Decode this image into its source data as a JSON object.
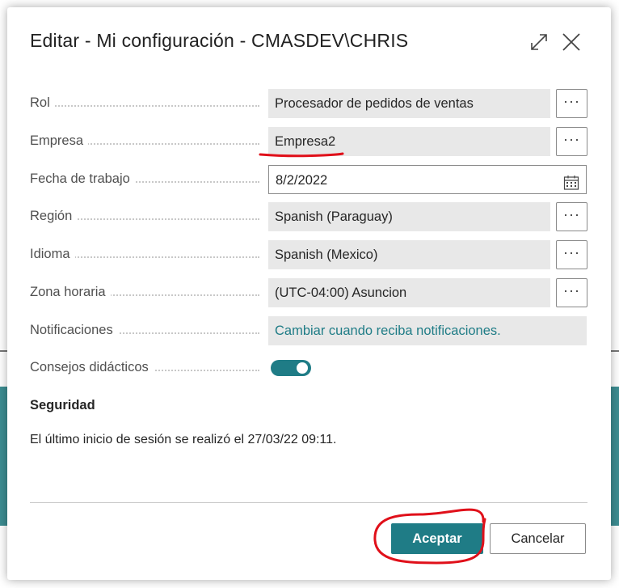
{
  "dialog": {
    "title": "Editar - Mi configuración - CMASDEV\\CHRIS",
    "expand_icon": "expand-icon",
    "close_icon": "close-icon"
  },
  "fields": {
    "rol": {
      "label": "Rol",
      "value": "Procesador de pedidos de ventas"
    },
    "empresa": {
      "label": "Empresa",
      "value": "Empresa2"
    },
    "fecha": {
      "label": "Fecha de trabajo",
      "value": "8/2/2022"
    },
    "region": {
      "label": "Región",
      "value": "Spanish (Paraguay)"
    },
    "idioma": {
      "label": "Idioma",
      "value": "Spanish (Mexico)"
    },
    "zona": {
      "label": "Zona horaria",
      "value": "(UTC-04:00) Asuncion"
    },
    "notificaciones": {
      "label": "Notificaciones",
      "value": "Cambiar cuando reciba notificaciones."
    },
    "consejos": {
      "label": "Consejos didácticos",
      "value": true
    }
  },
  "more_button_label": "···",
  "security": {
    "title": "Seguridad",
    "last_login": "El último inicio de sesión se realizó el 27/03/22 09:11."
  },
  "buttons": {
    "accept": "Aceptar",
    "cancel": "Cancelar"
  },
  "colors": {
    "accent": "#1f7c86",
    "annotation": "#e0101a"
  }
}
